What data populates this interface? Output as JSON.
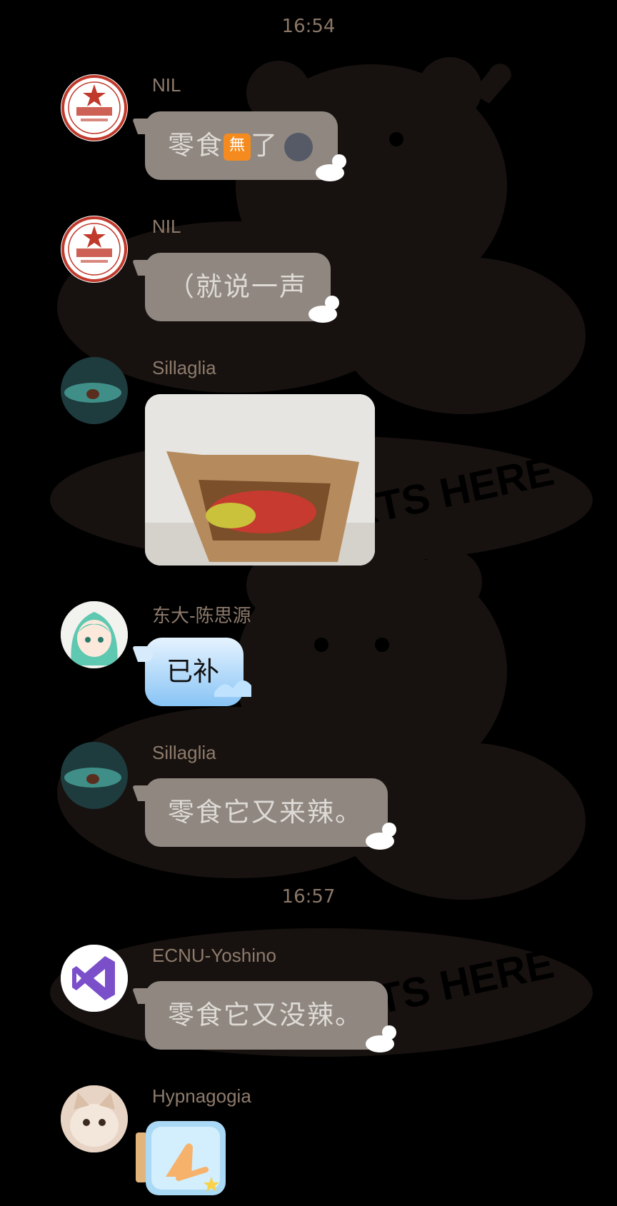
{
  "timestamps": [
    "16:54",
    "16:57"
  ],
  "messages": [
    {
      "sender": "NIL",
      "text_prefix": "零食",
      "text_emoji": "無",
      "text_suffix": "了",
      "avatar": "university-seal-avatar"
    },
    {
      "sender": "NIL",
      "text": "（就说一声",
      "avatar": "university-seal-avatar"
    },
    {
      "sender": "Sillaglia",
      "type": "image",
      "image_desc": "box-of-snacks-photo",
      "avatar": "ocean-avatar"
    },
    {
      "sender": "东大-陈思源",
      "text": "已补",
      "avatar": "anime-girl-avatar"
    },
    {
      "sender": "Sillaglia",
      "text": "零食它又来辣。",
      "avatar": "ocean-avatar"
    },
    {
      "sender": "ECNU-Yoshino",
      "text": "零食它又没辣。",
      "avatar": "visual-studio-avatar"
    },
    {
      "sender": "Hypnagogia",
      "type": "sticker",
      "sticker": "praying-hands-jar",
      "avatar": "cat-avatar"
    }
  ],
  "background": {
    "watermark_text": "FUN STARTS HERE"
  },
  "colors": {
    "bubble": "#8f8780",
    "text": "#dedad6",
    "name": "#8e7b6c"
  }
}
